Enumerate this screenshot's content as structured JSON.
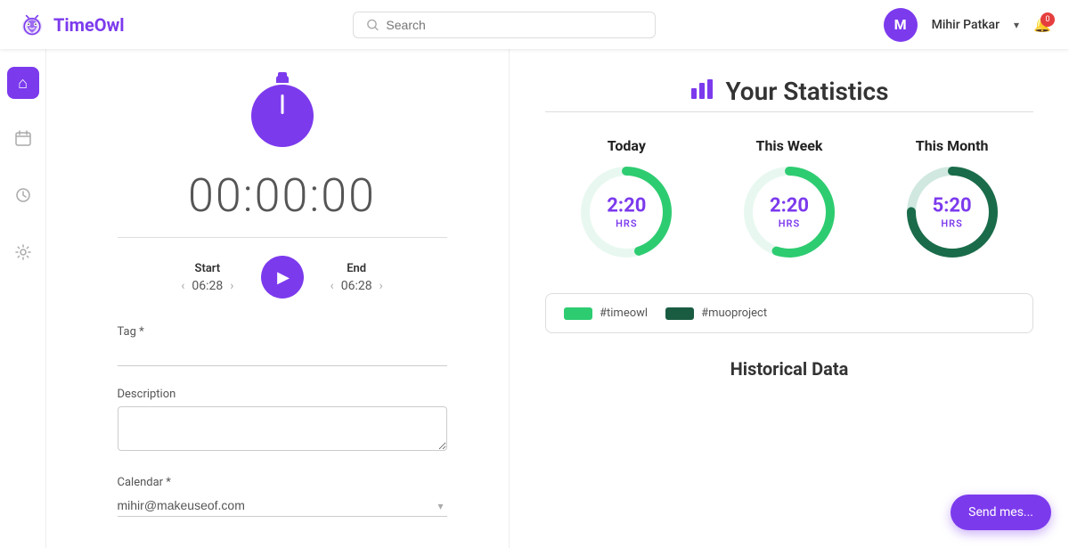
{
  "app": {
    "name": "TimeOwl",
    "logo_alt": "TimeOwl logo"
  },
  "topnav": {
    "search_placeholder": "Search",
    "user_name": "Mihir Patkar",
    "user_initial": "M",
    "notification_count": "0",
    "chevron": "▾"
  },
  "sidebar": {
    "items": [
      {
        "id": "home",
        "icon": "⌂",
        "active": true
      },
      {
        "id": "calendar",
        "icon": "▦",
        "active": false
      },
      {
        "id": "history",
        "icon": "◷",
        "active": false
      },
      {
        "id": "settings",
        "icon": "⚙",
        "active": false
      }
    ]
  },
  "timer": {
    "display": "00:00:00",
    "start_label": "Start",
    "start_time": "06:28",
    "end_label": "End",
    "end_time": "06:28"
  },
  "form": {
    "tag_label": "Tag *",
    "tag_placeholder": "",
    "description_label": "Description",
    "description_placeholder": "",
    "calendar_label": "Calendar *",
    "calendar_value": "mihir@makeuseof.com"
  },
  "statistics": {
    "title": "Your Statistics",
    "periods": [
      {
        "label": "Today",
        "value": "2:20",
        "unit": "HRS",
        "progress": 0.45,
        "color_fg": "#2ecc71",
        "color_bg": "#e8f8f0"
      },
      {
        "label": "This Week",
        "value": "2:20",
        "unit": "HRS",
        "progress": 0.55,
        "color_fg": "#2ecc71",
        "color_bg": "#e8f8f0"
      },
      {
        "label": "This Month",
        "value": "5:20",
        "unit": "HRS",
        "progress": 0.75,
        "color_fg": "#1a6b4a",
        "color_bg": "#e0ede8"
      }
    ]
  },
  "legend": {
    "items": [
      {
        "color": "#2ecc71",
        "label": "#timeowl"
      },
      {
        "color": "#1a5c42",
        "label": "#muoproject"
      }
    ]
  },
  "historical": {
    "title": "Historical Data"
  },
  "chat": {
    "label": "Send mes..."
  }
}
